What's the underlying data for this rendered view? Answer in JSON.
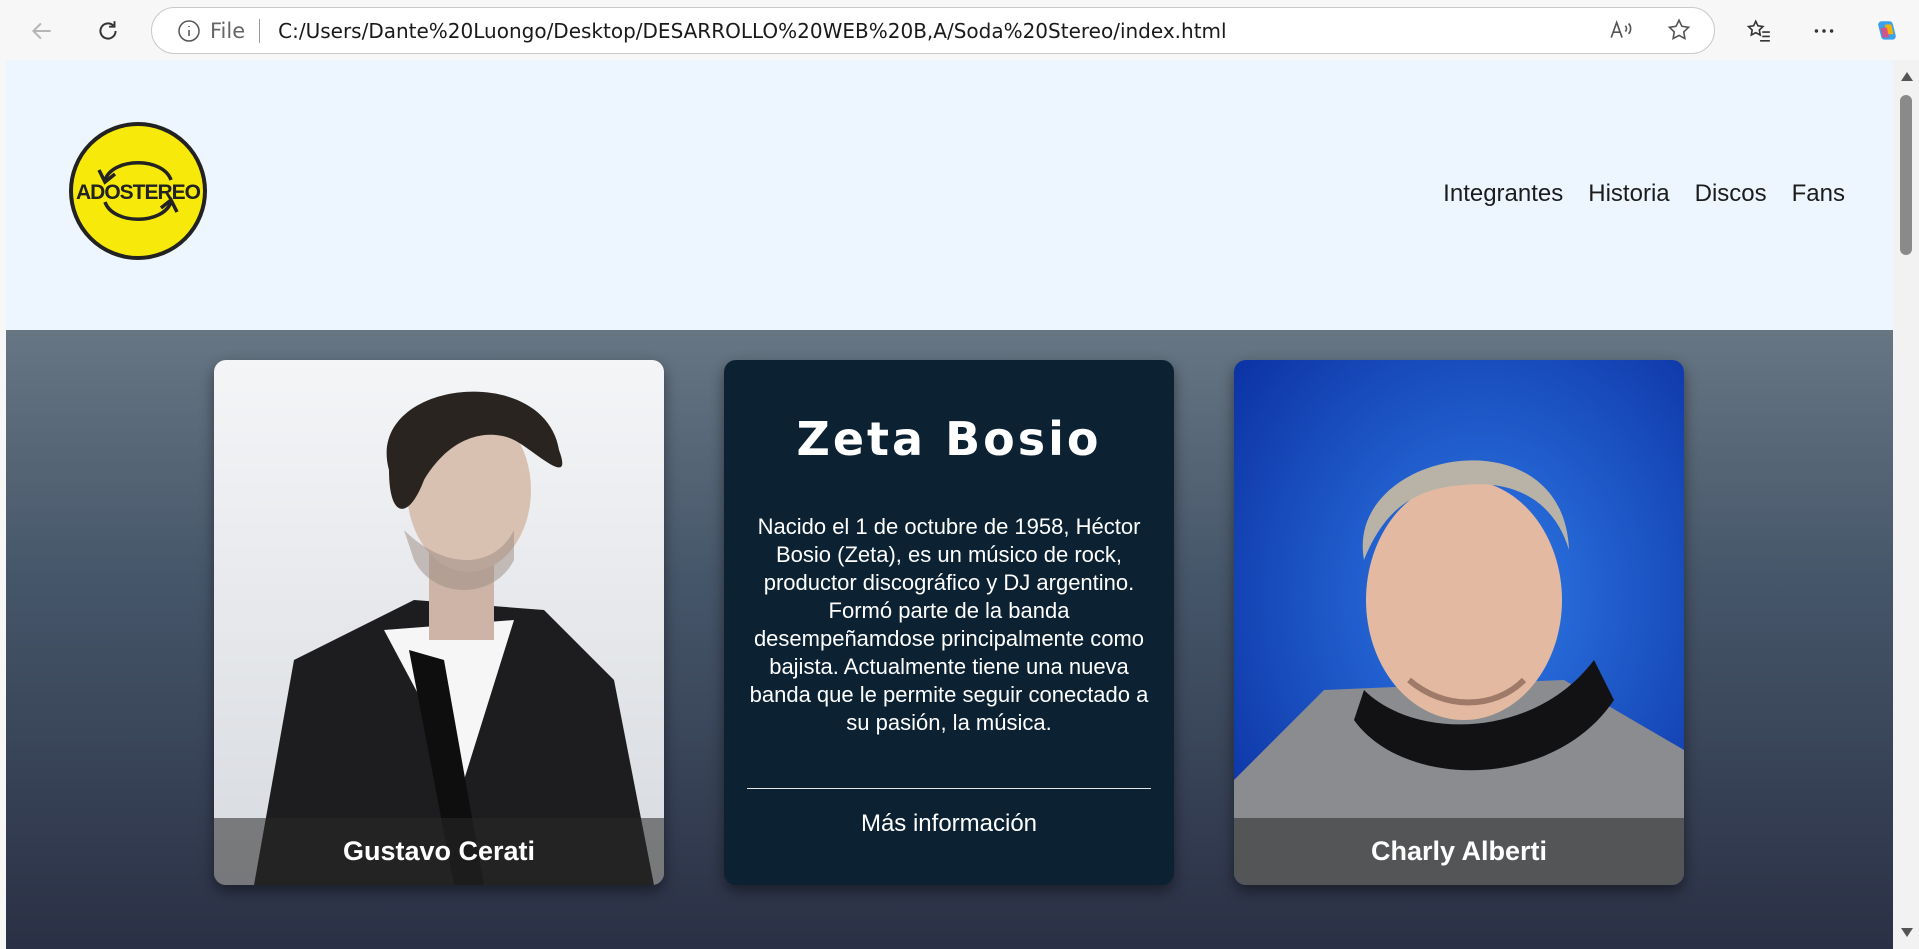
{
  "browser": {
    "file_label": "File",
    "url": "C:/Users/Dante%20Luongo/Desktop/DESARROLLO%20WEB%20B,A/Soda%20Stereo/index.html",
    "icons": [
      "back-arrow-icon",
      "refresh-icon",
      "info-icon",
      "read-aloud-icon",
      "star-icon",
      "favorites-icon",
      "more-icon",
      "copilot-icon"
    ]
  },
  "site": {
    "logo_text": "SODASTEREO",
    "nav": [
      {
        "label": "Integrantes"
      },
      {
        "label": "Historia"
      },
      {
        "label": "Discos"
      },
      {
        "label": "Fans"
      }
    ]
  },
  "cards": [
    {
      "name": "Gustavo Cerati"
    },
    {
      "title": "Zeta Bosio",
      "text": "Nacido el 1 de octubre de 1958, Héctor Bosio (Zeta), es un músico de rock, productor discográfico y DJ argentino. Formó parte de la banda desempeñamdose principalmente como bajista. Actualmente tiene una nueva banda que le permite seguir conectado a su pasión, la música.",
      "link": "Más información"
    },
    {
      "name": "Charly Alberti"
    }
  ],
  "colors": {
    "header_bg": "#edf6ff",
    "logo_yellow": "#f7ea0b",
    "info_card_bg": "#0c2233",
    "section_gradient_top": "#677683",
    "section_gradient_bottom": "#2a3045"
  }
}
